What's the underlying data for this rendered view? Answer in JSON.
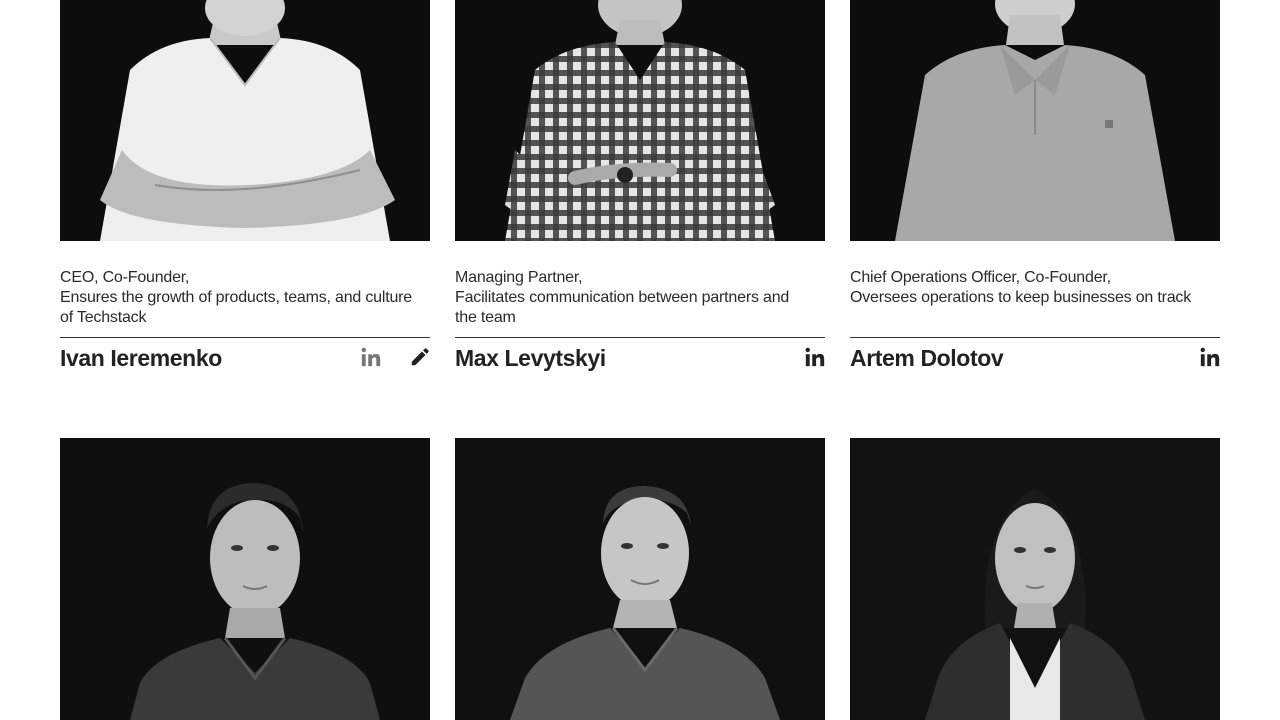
{
  "team": {
    "members": [
      {
        "name": "Ivan Ieremenko",
        "role_lines": [
          "CEO, Co-Founder,",
          "Ensures the growth of products, teams, and culture",
          "of Techstack"
        ],
        "icons": [
          "linkedin-icon",
          "edit-icon"
        ],
        "photo": "man-white-tshirt"
      },
      {
        "name": "Max Levytskyi",
        "role_lines": [
          "Managing Partner,",
          "Facilitates communication between partners and",
          "the team"
        ],
        "icons": [
          "linkedin-icon"
        ],
        "photo": "man-checkered-shirt"
      },
      {
        "name": "Artem Dolotov",
        "role_lines": [
          "Chief Operations Officer, Co-Founder,",
          "Oversees operations to keep businesses on track"
        ],
        "icons": [
          "linkedin-icon"
        ],
        "photo": "man-polo-shirt"
      },
      {
        "photo": "man-dark-polo"
      },
      {
        "photo": "man-short-hair-polo"
      },
      {
        "photo": "woman-blazer"
      }
    ]
  },
  "colors": {
    "text": "#222222",
    "background": "#ffffff",
    "icon_muted": "#777777",
    "icon_dark": "#222222"
  }
}
